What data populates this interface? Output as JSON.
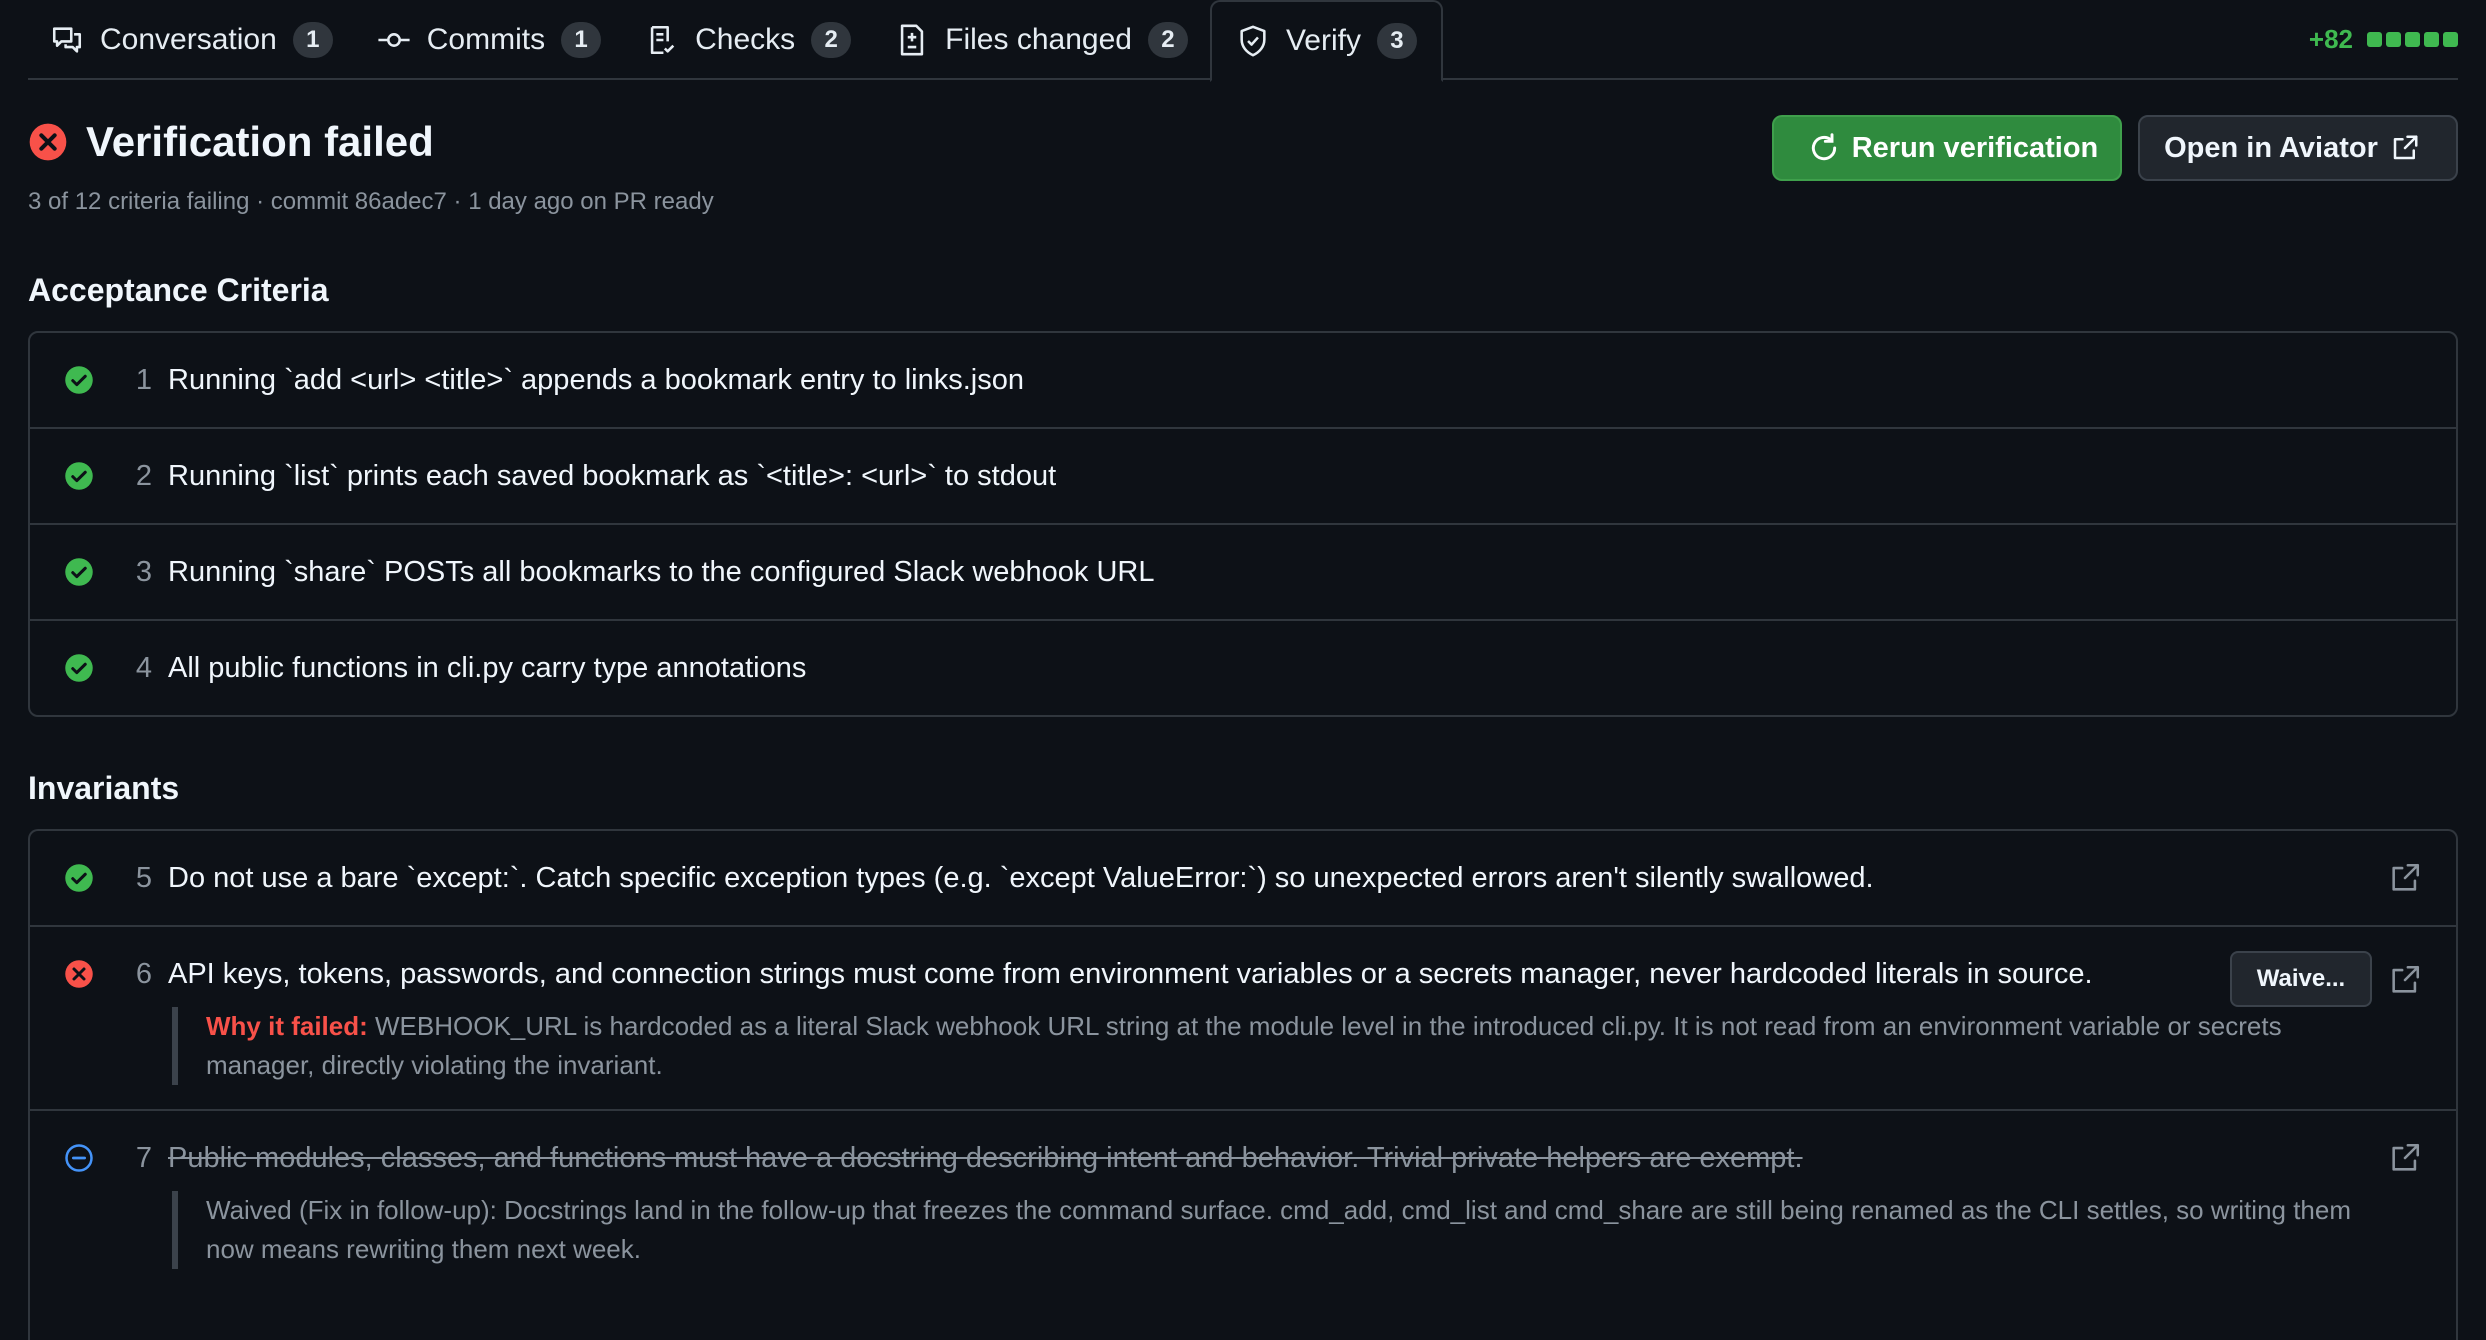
{
  "tabs": [
    {
      "label": "Conversation",
      "count": "1",
      "icon": "comment-discussion-icon"
    },
    {
      "label": "Commits",
      "count": "1",
      "icon": "git-commit-icon"
    },
    {
      "label": "Checks",
      "count": "2",
      "icon": "checklist-icon"
    },
    {
      "label": "Files changed",
      "count": "2",
      "icon": "file-diff-icon"
    },
    {
      "label": "Verify",
      "count": "3",
      "icon": "shield-check-icon",
      "active": true
    }
  ],
  "diffstat": {
    "additions": "+82"
  },
  "header": {
    "title": "Verification failed",
    "subtitle": "3 of 12 criteria failing · commit 86adec7 · 1 day ago on PR ready",
    "rerun_label": "Rerun verification",
    "aviator_label": "Open in Aviator"
  },
  "acceptance": {
    "title": "Acceptance Criteria",
    "items": [
      {
        "num": "1",
        "status": "pass",
        "text": "Running `add <url> <title>` appends a bookmark entry to links.json"
      },
      {
        "num": "2",
        "status": "pass",
        "text": "Running `list` prints each saved bookmark as `<title>: <url>` to stdout"
      },
      {
        "num": "3",
        "status": "pass",
        "text": "Running `share` POSTs all bookmarks to the configured Slack webhook URL"
      },
      {
        "num": "4",
        "status": "pass",
        "text": "All public functions in cli.py carry type annotations"
      }
    ]
  },
  "invariants": {
    "title": "Invariants",
    "items": [
      {
        "num": "5",
        "status": "pass",
        "text": "Do not use a bare `except:`. Catch specific exception types (e.g. `except ValueError:`) so unexpected errors aren't silently swallowed."
      },
      {
        "num": "6",
        "status": "fail",
        "text": "API keys, tokens, passwords, and connection strings must come from environment variables or a secrets manager, never hardcoded literals in source.",
        "waive_label": "Waive...",
        "why_label": "Why it failed:",
        "why_text": " WEBHOOK_URL is hardcoded as a literal Slack webhook URL string at the module level in the introduced cli.py. It is not read from an environment variable or secrets manager, directly violating the invariant."
      },
      {
        "num": "7",
        "status": "waived",
        "text": "Public modules, classes, and functions must have a docstring describing intent and behavior. Trivial private helpers are exempt.",
        "note": "Waived (Fix in follow-up): Docstrings land in the follow-up that freezes the command surface. cmd_add, cmd_list and cmd_share are still being renamed as the CLI settles, so writing them now means rewriting them next week."
      }
    ]
  },
  "colors": {
    "pass": "#3fb950",
    "fail": "#f85149",
    "waived": "#4493f8",
    "primary_button": "#2f8b3e"
  }
}
